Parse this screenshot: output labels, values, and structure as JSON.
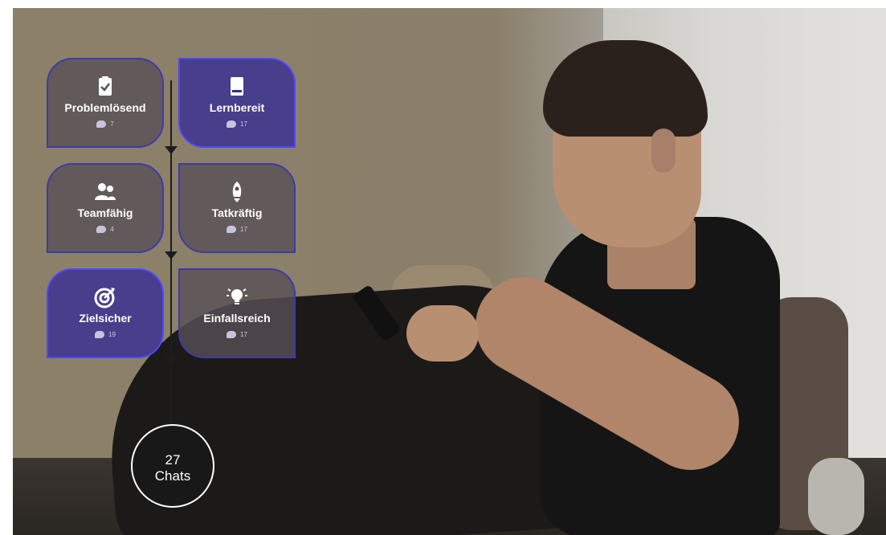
{
  "tiles": [
    {
      "label": "Problemlösend",
      "count": "7",
      "icon": "clipboard-check-icon"
    },
    {
      "label": "Lernbereit",
      "count": "17",
      "icon": "book-icon"
    },
    {
      "label": "Teamfähig",
      "count": "4",
      "icon": "users-icon"
    },
    {
      "label": "Tatkräftig",
      "count": "17",
      "icon": "rocket-icon"
    },
    {
      "label": "Zielsicher",
      "count": "19",
      "icon": "target-icon"
    },
    {
      "label": "Einfallsreich",
      "count": "17",
      "icon": "lightbulb-icon"
    }
  ],
  "summary": {
    "count": "27",
    "label": "Chats"
  },
  "colors": {
    "accent": "#4d49ff",
    "tile_bg": "#585056",
    "tile_highlight": "#342c96"
  }
}
